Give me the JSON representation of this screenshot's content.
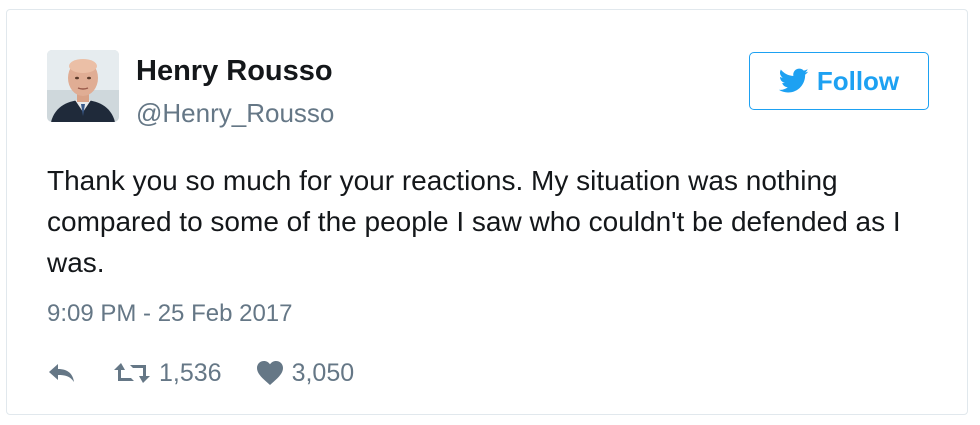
{
  "user": {
    "display_name": "Henry Rousso",
    "handle": "@Henry_Rousso",
    "avatar_icon": "profile-photo"
  },
  "follow_button": {
    "label": "Follow",
    "icon": "twitter-bird-icon",
    "color": "#1da1f2"
  },
  "tweet": {
    "text": "Thank you so much for your reactions. My situation was nothing compared to some of the people I saw who couldn't be defended as I was.",
    "timestamp": "9:09 PM - 25 Feb 2017"
  },
  "actions": {
    "reply_icon": "reply-icon",
    "retweet_icon": "retweet-icon",
    "retweet_count": "1,536",
    "like_icon": "heart-icon",
    "like_count": "3,050"
  },
  "colors": {
    "text": "#14171a",
    "secondary": "#657786",
    "border": "#e1e8ed",
    "brand": "#1da1f2"
  }
}
